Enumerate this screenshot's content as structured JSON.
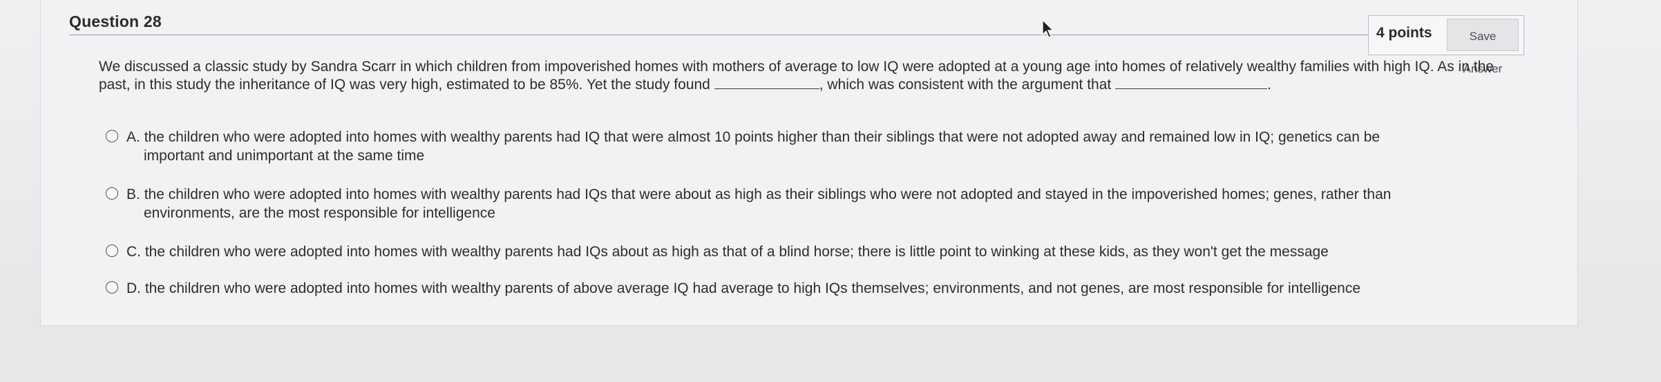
{
  "question": {
    "title": "Question 28",
    "points": "4 points",
    "save_label": "Save Answer",
    "prompt_part1": "We discussed a classic study by Sandra Scarr in which children from impoverished homes with mothers of average to low IQ were adopted at a young age into homes of relatively wealthy families with high IQ. As in the past, in this study the inheritance of IQ was very high, estimated to be 85%. Yet the study found ",
    "prompt_part2": ", which was consistent with the argument that ",
    "prompt_part3": "."
  },
  "choices": [
    {
      "letter": "A.",
      "line1": "the children who were adopted into homes with wealthy parents had IQ that were almost 10 points higher than their siblings that were not adopted away and remained low in IQ; genetics can be",
      "line2": "important and unimportant at the same time"
    },
    {
      "letter": "B.",
      "line1": "the children who were adopted into homes with wealthy parents had IQs that were about as high as their siblings who were not adopted and stayed in the impoverished homes; genes, rather than",
      "line2": "environments, are the most responsible for intelligence"
    },
    {
      "letter": "C.",
      "line1": "the children who were adopted into homes with wealthy parents had IQs about as high as that of a blind horse; there is little point to winking at these kids, as they won't get the message",
      "line2": ""
    },
    {
      "letter": "D.",
      "line1": "the children who were adopted into homes with wealthy parents of above average IQ had average to high IQs themselves; environments, and not genes, are most responsible for intelligence",
      "line2": ""
    }
  ],
  "icons": {
    "cursor": "mouse-pointer-icon",
    "radio": "radio-unselected-icon"
  },
  "colors": {
    "background": "#e9eaec",
    "text": "#2d2d2d",
    "button_bg": "#e4e5e7"
  }
}
